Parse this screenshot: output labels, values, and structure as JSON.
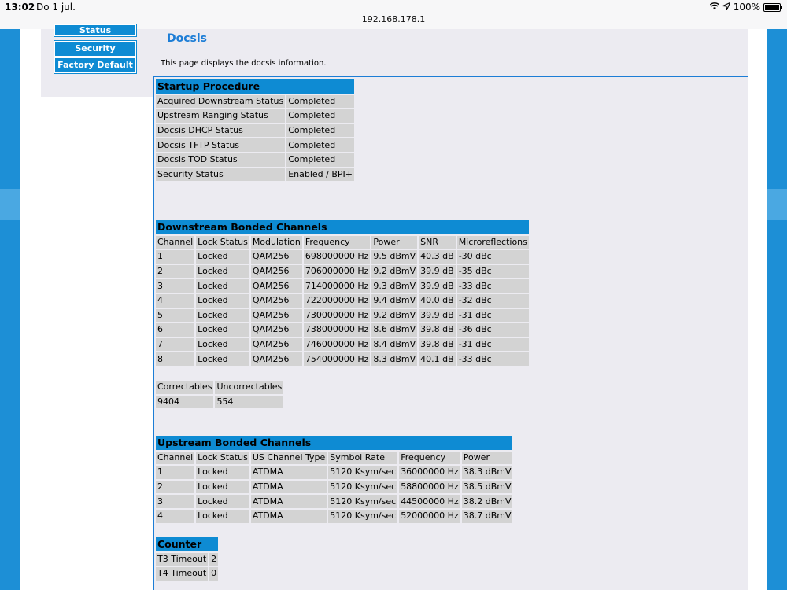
{
  "statusbar": {
    "time": "13:02",
    "date": "Do 1 jul.",
    "url": "192.168.178.1",
    "battery": "100%",
    "battery_level": 1.0
  },
  "sidebar": {
    "items": [
      {
        "label": "Status"
      },
      {
        "label": "Security"
      },
      {
        "label": "Factory Default"
      }
    ]
  },
  "page": {
    "title": "Docsis",
    "description": "This page displays the docsis information."
  },
  "startup": {
    "header": "Startup Procedure",
    "rows": [
      [
        "Acquired Downstream Status",
        "Completed"
      ],
      [
        "Upstream Ranging Status",
        "Completed"
      ],
      [
        "Docsis DHCP Status",
        "Completed"
      ],
      [
        "Docsis TFTP Status",
        "Completed"
      ],
      [
        "Docsis TOD Status",
        "Completed"
      ],
      [
        "Security Status",
        "Enabled / BPI+"
      ]
    ]
  },
  "downstream": {
    "header": "Downstream Bonded Channels",
    "columns": [
      "Channel",
      "Lock Status",
      "Modulation",
      "Frequency",
      "Power",
      "SNR",
      "Microreflections"
    ],
    "rows": [
      [
        "1",
        "Locked",
        "QAM256",
        "698000000 Hz",
        "9.5 dBmV",
        "40.3 dB",
        "-30 dBc"
      ],
      [
        "2",
        "Locked",
        "QAM256",
        "706000000 Hz",
        "9.2 dBmV",
        "39.9 dB",
        "-35 dBc"
      ],
      [
        "3",
        "Locked",
        "QAM256",
        "714000000 Hz",
        "9.3 dBmV",
        "39.9 dB",
        "-33 dBc"
      ],
      [
        "4",
        "Locked",
        "QAM256",
        "722000000 Hz",
        "9.4 dBmV",
        "40.0 dB",
        "-32 dBc"
      ],
      [
        "5",
        "Locked",
        "QAM256",
        "730000000 Hz",
        "9.2 dBmV",
        "39.9 dB",
        "-31 dBc"
      ],
      [
        "6",
        "Locked",
        "QAM256",
        "738000000 Hz",
        "8.6 dBmV",
        "39.8 dB",
        "-36 dBc"
      ],
      [
        "7",
        "Locked",
        "QAM256",
        "746000000 Hz",
        "8.4 dBmV",
        "39.8 dB",
        "-31 dBc"
      ],
      [
        "8",
        "Locked",
        "QAM256",
        "754000000 Hz",
        "8.3 dBmV",
        "40.1 dB",
        "-33 dBc"
      ]
    ]
  },
  "errors": {
    "columns": [
      "Correctables",
      "Uncorrectables"
    ],
    "values": [
      "9404",
      "554"
    ]
  },
  "upstream": {
    "header": "Upstream Bonded Channels",
    "columns": [
      "Channel",
      "Lock Status",
      "US Channel Type",
      "Symbol Rate",
      "Frequency",
      "Power"
    ],
    "rows": [
      [
        "1",
        "Locked",
        "ATDMA",
        "5120 Ksym/sec",
        "36000000 Hz",
        "38.3 dBmV"
      ],
      [
        "2",
        "Locked",
        "ATDMA",
        "5120 Ksym/sec",
        "58800000 Hz",
        "38.5 dBmV"
      ],
      [
        "3",
        "Locked",
        "ATDMA",
        "5120 Ksym/sec",
        "44500000 Hz",
        "38.2 dBmV"
      ],
      [
        "4",
        "Locked",
        "ATDMA",
        "5120 Ksym/sec",
        "52000000 Hz",
        "38.7 dBmV"
      ]
    ]
  },
  "counter": {
    "header": "Counter",
    "rows": [
      [
        "T3 Timeout",
        "2"
      ],
      [
        "T4 Timeout",
        "0"
      ]
    ]
  },
  "colors": {
    "accent": "#0e8bd3",
    "title": "#1c7dd6",
    "cell": "#d3d3d3",
    "content_bg": "#ecebf1"
  }
}
